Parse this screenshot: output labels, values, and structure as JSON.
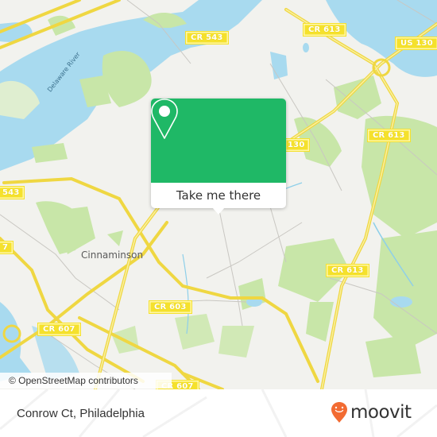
{
  "map": {
    "place_labels": [
      {
        "id": "cinnaminson",
        "text": "Cinnaminson"
      }
    ],
    "water_labels": [
      {
        "id": "delaware-river",
        "text": "Delaware River"
      }
    ],
    "road_shields": [
      {
        "id": "cr543-top",
        "text": "CR 543"
      },
      {
        "id": "cr613-top",
        "text": "CR 613"
      },
      {
        "id": "us130-top",
        "text": "US 130"
      },
      {
        "id": "cr613-mid",
        "text": "CR 613"
      },
      {
        "id": "us130-mid",
        "text": "130"
      },
      {
        "id": "cr543-left",
        "text": "543"
      },
      {
        "id": "cr607-left",
        "text": "7"
      },
      {
        "id": "cr613-lower",
        "text": "CR 613"
      },
      {
        "id": "cr603",
        "text": "CR 603"
      },
      {
        "id": "cr607",
        "text": "CR 607"
      },
      {
        "id": "cr607-bottom",
        "text": "CR 607"
      }
    ],
    "attribution": "© OpenStreetMap contributors",
    "colors": {
      "land": "#f2f2ee",
      "water": "#a8daef",
      "park": "#c8e6a8",
      "road_major": "#f5e12c"
    }
  },
  "popup": {
    "icon": "map-pin-icon",
    "button_label": "Take me there",
    "color": "#1fb866"
  },
  "footer": {
    "address": "Conrow Ct, Philadelphia",
    "brand": "moovit",
    "brand_icon": "moovit-logo-icon",
    "brand_color": "#f26b32"
  }
}
